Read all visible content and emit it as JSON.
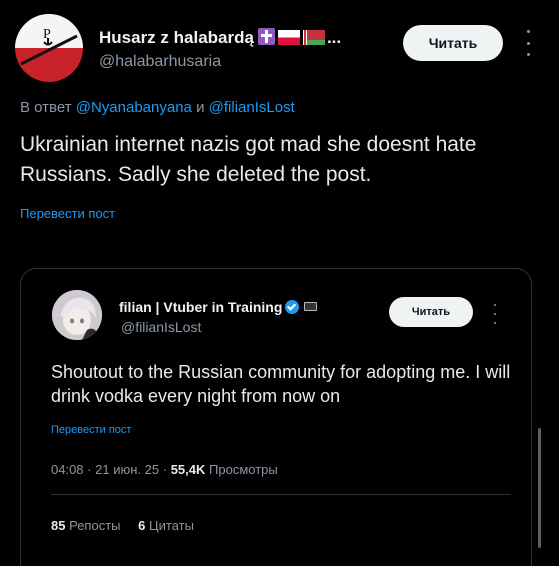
{
  "tweet": {
    "author_name": "Husarz z halabardą",
    "author_name_ellipsis": "...",
    "author_handle": "@halabarhusaria",
    "follow_label": "Читать",
    "reply_prefix": "В ответ",
    "reply_mention_1": "@Nyanabanyana",
    "reply_and": "и",
    "reply_mention_2": "@filianIsLost",
    "text": "Ukrainian internet nazis got mad she doesnt hate Russians. Sadly she deleted the post.",
    "translate_label": "Перевести пост",
    "badges": [
      "cross-icon",
      "poland-flag-icon",
      "belarus-flag-icon"
    ]
  },
  "quoted": {
    "author_name": "filian | Vtuber in Training",
    "author_handle": "@filianIsLost",
    "follow_label": "Читать",
    "text": "Shoutout to the Russian community for adopting me. I will drink vodka every night from now on",
    "translate_label": "Перевести пост",
    "time": "04:08",
    "date": "21 июн. 25",
    "separator": "·",
    "views_count": "55,4K",
    "views_label": "Просмотры",
    "reposts_count": "85",
    "reposts_label": "Репосты",
    "quotes_count": "6",
    "quotes_label": "Цитаты"
  },
  "colors": {
    "background": "#000000",
    "link": "#1d9bf0",
    "muted": "#8b98a5",
    "text": "#e7e9ea"
  }
}
